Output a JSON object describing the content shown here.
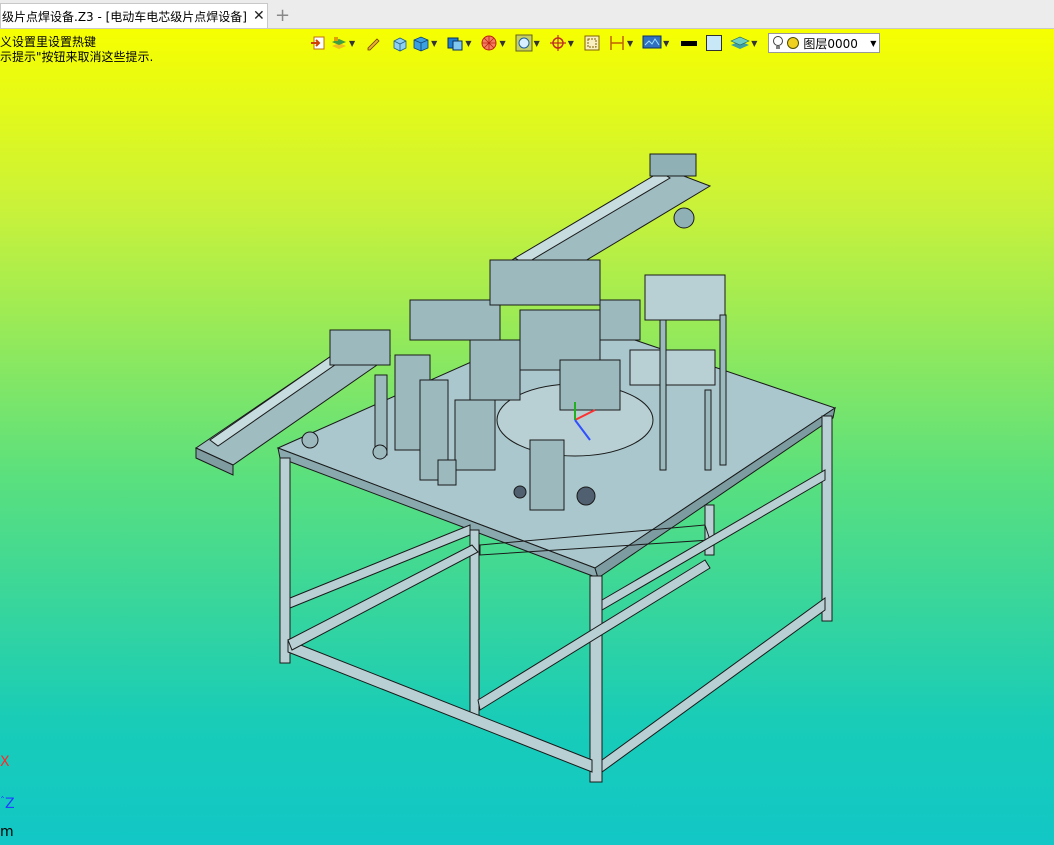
{
  "tab": {
    "title": "级片点焊设备.Z3 - [电动车电芯级片点焊设备]",
    "close_glyph": "✕",
    "new_glyph": "+"
  },
  "hints": {
    "line1": "义设置里设置热键",
    "line2": "示提示\"按钮来取消这些提示."
  },
  "toolbar": {
    "icons": [
      "exit-icon",
      "layers-icon",
      "pencil-icon",
      "box-small-icon",
      "cube-icon",
      "cube-blue-icon",
      "wheel-icon",
      "circle-view-icon",
      "target-icon",
      "frame-icon",
      "dimension-icon",
      "monitor-icon",
      "black-line-icon",
      "square-color-icon",
      "layer-stack-icon"
    ],
    "layer": {
      "label": "图层0000"
    }
  },
  "axes": {
    "x": "X",
    "z": "Z",
    "unit": "m"
  },
  "colors": {
    "x_axis": "#ff2a2a",
    "z_axis": "#2040ff"
  }
}
